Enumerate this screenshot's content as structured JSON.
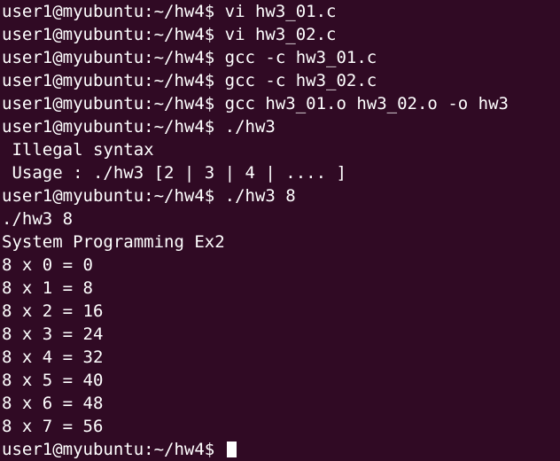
{
  "terminal": {
    "lines": [
      "user1@myubuntu:~/hw4$ vi hw3_01.c",
      "user1@myubuntu:~/hw4$ vi hw3_02.c",
      "user1@myubuntu:~/hw4$ gcc -c hw3_01.c",
      "user1@myubuntu:~/hw4$ gcc -c hw3_02.c",
      "user1@myubuntu:~/hw4$ gcc hw3_01.o hw3_02.o -o hw3",
      "user1@myubuntu:~/hw4$ ./hw3",
      " Illegal syntax",
      " Usage : ./hw3 [2 | 3 | 4 | .... ]",
      "user1@myubuntu:~/hw4$ ./hw3 8",
      "./hw3 8",
      "System Programming Ex2",
      "8 x 0 = 0",
      "8 x 1 = 8",
      "8 x 2 = 16",
      "8 x 3 = 24",
      "8 x 4 = 32",
      "8 x 5 = 40",
      "8 x 6 = 48",
      "8 x 7 = 56"
    ],
    "prompt": "user1@myubuntu:~/hw4$ "
  }
}
